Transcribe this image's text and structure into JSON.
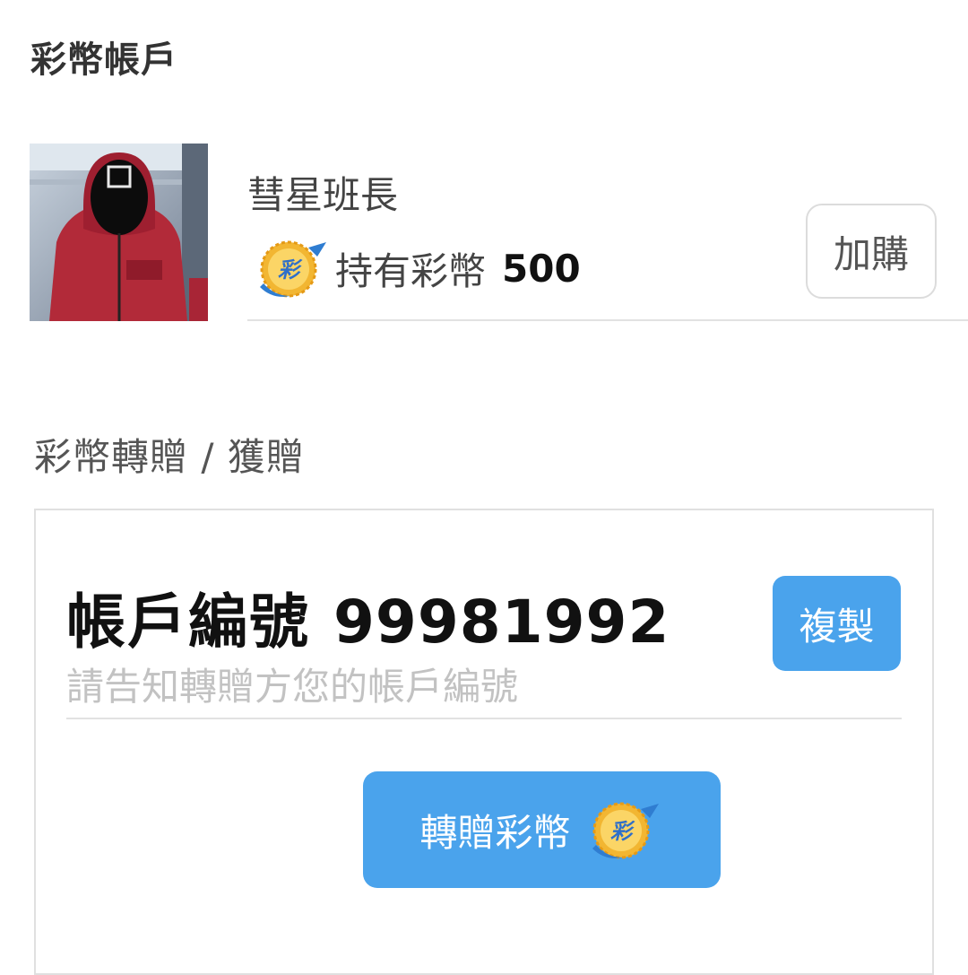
{
  "header": {
    "title": "彩幣帳戶"
  },
  "profile": {
    "name": "彗星班長",
    "avatar": "avatar-red-jumpsuit-masked-figure",
    "coin_icon": "lottery-coin-icon",
    "coin_icon_text": "彩",
    "coin_label": "持有彩幣",
    "coin_balance": "500",
    "buy_button": "加購"
  },
  "transfer_section": {
    "title": "彩幣轉贈 / 獲贈",
    "account_label": "帳戶編號",
    "account_number": "99981992",
    "hint": "請告知轉贈方您的帳戶編號",
    "copy_button": "複製",
    "transfer_button": "轉贈彩幣"
  },
  "colors": {
    "accent_blue": "#4aa3ec",
    "text_dark": "#333333",
    "hint_gray": "#c2c2c2",
    "divider": "#e2e2e2",
    "coin_gold": "#f2b632",
    "coin_blue": "#2f7dd1"
  }
}
